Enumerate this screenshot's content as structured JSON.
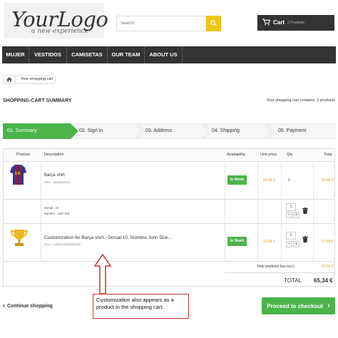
{
  "header": {
    "logo_main": "YourLogo",
    "logo_sub": "a new experience",
    "search_placeholder": "Search",
    "cart_label": "Cart",
    "cart_count": "2 Products"
  },
  "nav": {
    "items": [
      "MUJER",
      "VESTIDOS",
      "CAMISETAS",
      "OUR TEAM",
      "ABOUT US"
    ]
  },
  "breadcrumb": {
    "current": "Your shopping cart"
  },
  "page": {
    "title": "SHOPPING-CART SUMMARY",
    "cart_contains": "Your shopping cart contains: 2 products"
  },
  "steps": [
    "01. Summary",
    "02. Sign in",
    "03. Address",
    "04. Shipping",
    "05. Payment"
  ],
  "table": {
    "headers": {
      "product": "Product",
      "description": "Description",
      "availability": "Availability",
      "unit_price": "Unit price",
      "qty": "Qty",
      "total": "Total"
    },
    "rows": [
      {
        "name": "Barça shirt",
        "sku": "SKU : camiseta-fcb",
        "availability": "In Stock",
        "unit_price": "54,45 €",
        "qty": "1",
        "total": "54,45 €"
      },
      {
        "custom_line1": "Dorsal : 10",
        "custom_line2": "Nombre : John Doe",
        "qty": "1"
      },
      {
        "name": "Customization for Barça shirt - Dorsal:10, Nombre:John Doe...",
        "sku": "SKU : custom-camiseta-fcb",
        "availability": "In Stock",
        "unit_price": "10,89 €",
        "qty": "1",
        "total": "10,89 €"
      }
    ],
    "total_products_label": "Total products (tax incl.)",
    "total_products_value": "65,34 €",
    "total_label": "TOTAL",
    "total_value": "65,34 €"
  },
  "actions": {
    "continue_label": "Continue shopping",
    "checkout_label": "Proceed to checkout"
  },
  "annotation": {
    "text": "Customization also appears as a product in the shopping cart."
  },
  "colors": {
    "accent_green": "#4bb34a",
    "search_yellow": "#f1c40f",
    "nav_dark": "#333333",
    "price_orange": "#e89c28",
    "annotation_red": "#c0392b"
  }
}
